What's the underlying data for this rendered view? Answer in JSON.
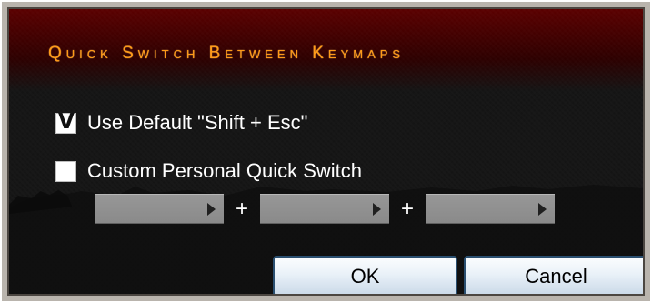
{
  "dialog": {
    "title": "Quick Switch Between Keymaps",
    "options": [
      {
        "label": "Use Default \"Shift + Esc\"",
        "checked": true,
        "check_glyph": "V"
      },
      {
        "label": "Custom Personal Quick Switch",
        "checked": false,
        "check_glyph": ""
      }
    ],
    "key_combo": {
      "separator": "+",
      "keys": [
        "",
        "",
        ""
      ]
    },
    "buttons": {
      "ok": "OK",
      "cancel": "Cancel"
    },
    "colors": {
      "title": "#ff9a18",
      "header_red": "#5a0000",
      "background": "#151515",
      "button_border": "#2a4f70",
      "dropdown_gray": "#979797"
    }
  }
}
